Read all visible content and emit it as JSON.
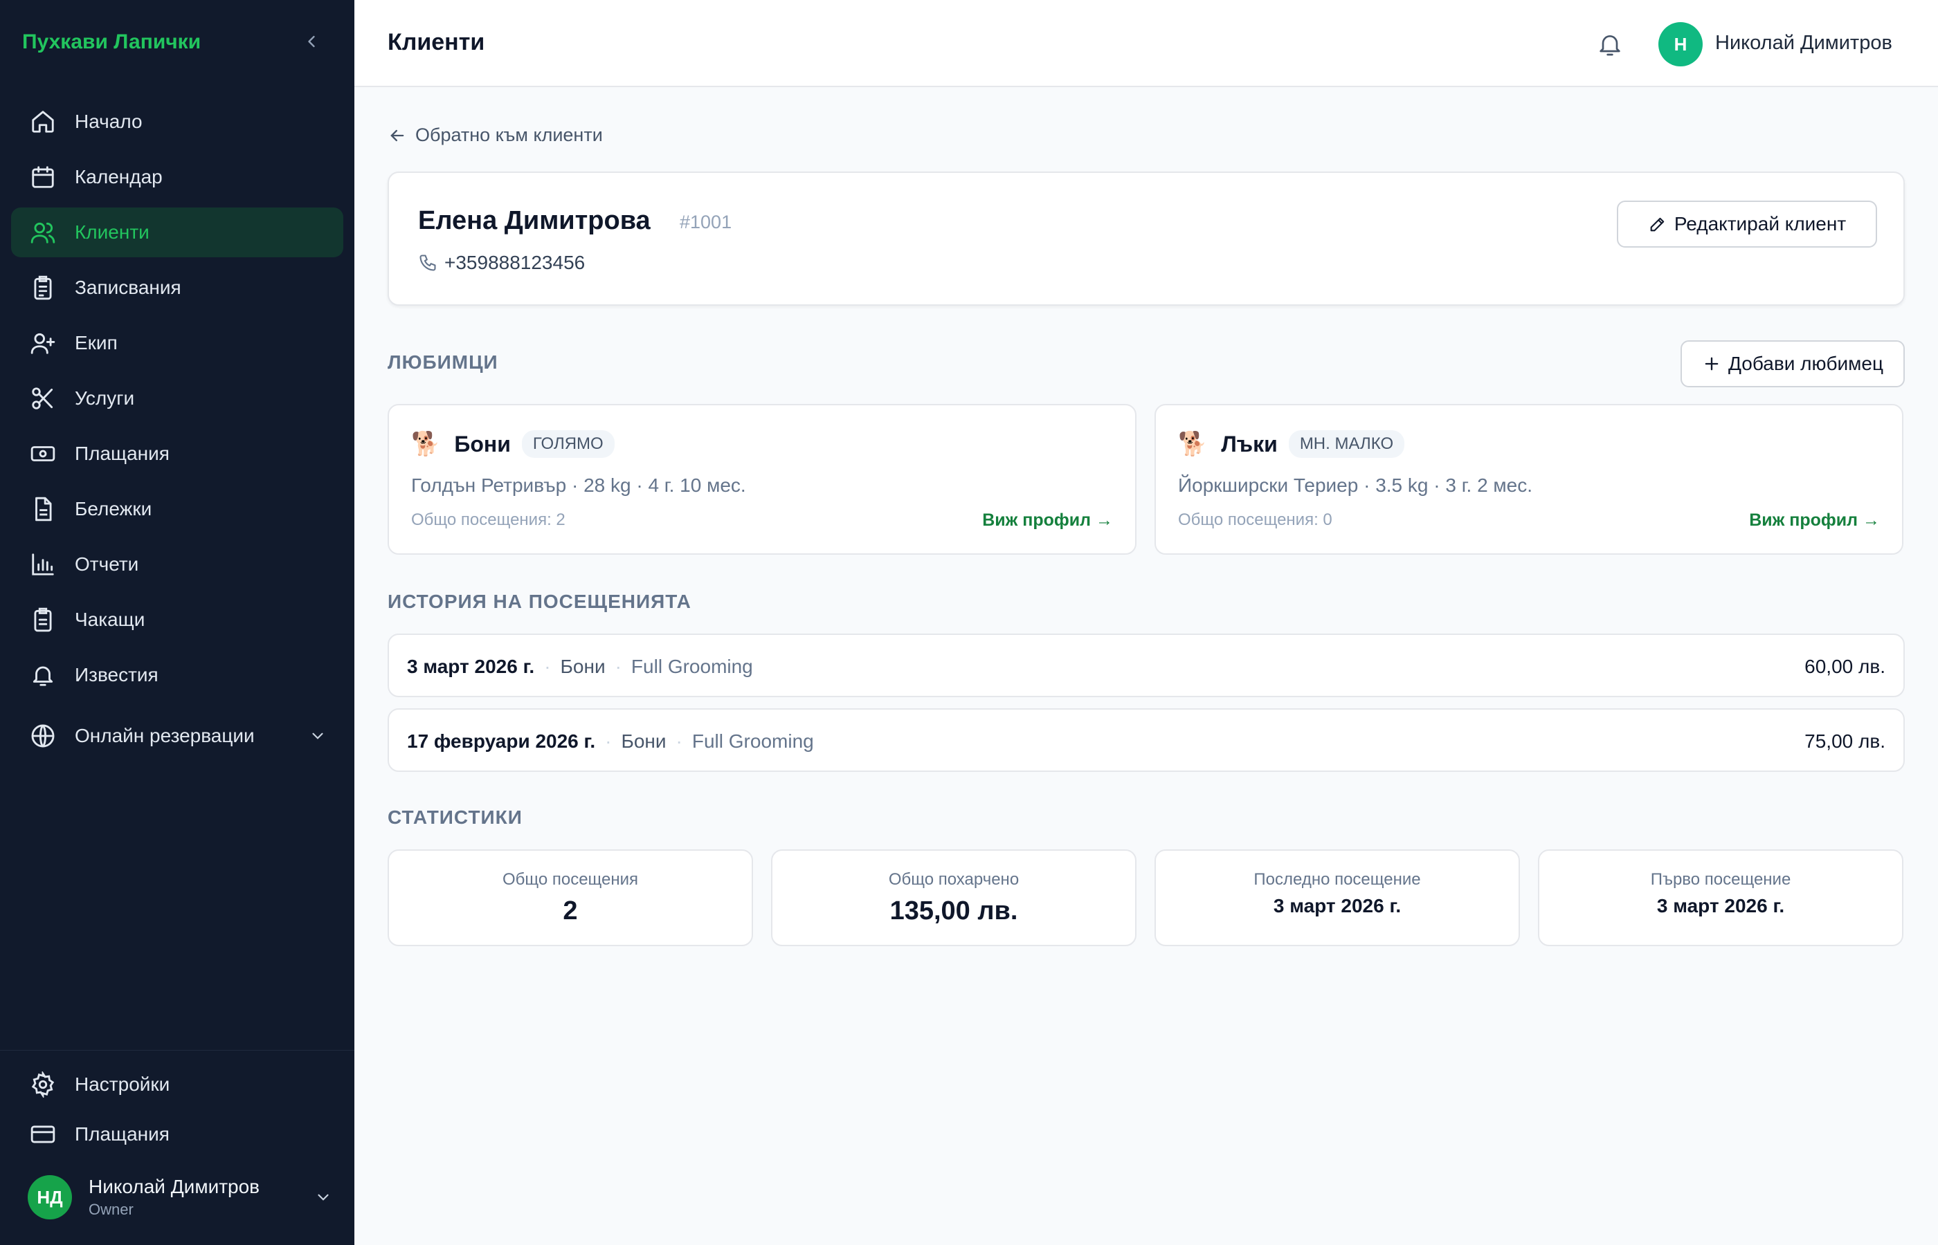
{
  "app": {
    "brand": "Пухкави Лапички"
  },
  "sidebar": {
    "items": [
      {
        "label": "Начало",
        "icon": "home-icon",
        "active": false
      },
      {
        "label": "Календар",
        "icon": "calendar-icon",
        "active": false
      },
      {
        "label": "Клиенти",
        "icon": "users-icon",
        "active": true
      },
      {
        "label": "Записвания",
        "icon": "clipboard-icon",
        "active": false
      },
      {
        "label": "Екип",
        "icon": "user-plus-icon",
        "active": false
      },
      {
        "label": "Услуги",
        "icon": "scissors-icon",
        "active": false
      },
      {
        "label": "Плащания",
        "icon": "cash-icon",
        "active": false
      },
      {
        "label": "Бележки",
        "icon": "document-icon",
        "active": false
      },
      {
        "label": "Отчети",
        "icon": "bar-chart-icon",
        "active": false
      },
      {
        "label": "Чакащи",
        "icon": "clipboard-list-icon",
        "active": false
      },
      {
        "label": "Известия",
        "icon": "bell-icon",
        "active": false
      },
      {
        "label": "Онлайн резервации",
        "icon": "globe-icon",
        "active": false
      }
    ],
    "bottom_items": [
      {
        "label": "Настройки",
        "icon": "gear-icon"
      },
      {
        "label": "Плащания",
        "icon": "credit-card-icon"
      }
    ],
    "user": {
      "initials": "НД",
      "name": "Николай Димитров",
      "role": "Owner"
    }
  },
  "topbar": {
    "title": "Клиенти",
    "user_initial": "Н",
    "user_name": "Николай Димитров"
  },
  "client": {
    "back_label": "Обратно към клиенти",
    "name": "Елена Димитрова",
    "id": "#1001",
    "phone": "+359888123456",
    "edit_label": "Редактирай клиент"
  },
  "pets": {
    "title": "ЛЮБИМЦИ",
    "add_label": "Добави любимец",
    "items": [
      {
        "emoji": "🐕",
        "name": "Бони",
        "size": "ГОЛЯМО",
        "info": "Голдън Ретривър · 28 kg · 4 г. 10 мес.",
        "visits": "Общо посещения: 2",
        "link": "Виж профил →"
      },
      {
        "emoji": "🐕",
        "name": "Лъки",
        "size": "МН. МАЛКО",
        "info": "Йоркширски Териер · 3.5 kg · 3 г. 2 мес.",
        "visits": "Общо посещения: 0",
        "link": "Виж профил →"
      }
    ]
  },
  "history": {
    "title": "ИСТОРИЯ НА ПОСЕЩЕНИЯТА",
    "visits": [
      {
        "date": "3 март 2026 г.",
        "pet": "Бони",
        "service": "Full Grooming",
        "price": "60,00 лв."
      },
      {
        "date": "17 февруари 2026 г.",
        "pet": "Бони",
        "service": "Full Grooming",
        "price": "75,00 лв."
      }
    ]
  },
  "stats": {
    "title": "СТАТИСТИКИ",
    "items": [
      {
        "label": "Общо посещения",
        "value": "2"
      },
      {
        "label": "Общо похарчено",
        "value": "135,00 лв."
      },
      {
        "label": "Последно посещение",
        "value": "3 март 2026 г."
      },
      {
        "label": "Първо посещение",
        "value": "3 март 2026 г."
      }
    ]
  },
  "colors": {
    "accent": "#22c55e",
    "sidebar_bg": "#111a2c",
    "link": "#15803d"
  }
}
